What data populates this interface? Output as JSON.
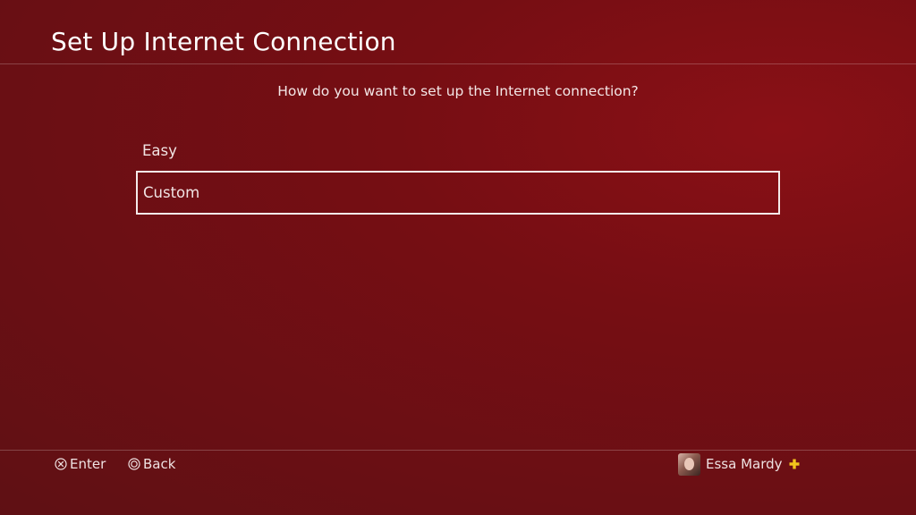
{
  "header": {
    "title": "Set Up Internet Connection"
  },
  "main": {
    "prompt": "How do you want to set up the Internet connection?",
    "options": [
      {
        "label": "Easy",
        "selected": false
      },
      {
        "label": "Custom",
        "selected": true
      }
    ]
  },
  "footer": {
    "enter_label": "Enter",
    "enter_icon": "cross-button-icon",
    "back_label": "Back",
    "back_icon": "circle-button-icon"
  },
  "user": {
    "name": "Essa Mardy",
    "plus_icon": "playstation-plus-icon",
    "plus_color": "#f4c51c"
  },
  "colors": {
    "background": "#6e0f14",
    "text": "#ffffff"
  }
}
